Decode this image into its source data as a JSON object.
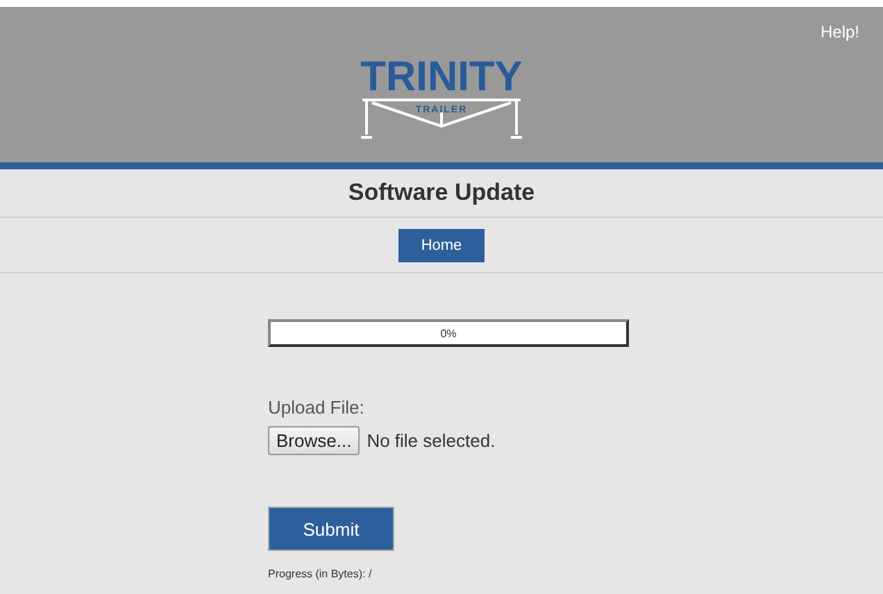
{
  "header": {
    "help_link": "Help!",
    "logo": {
      "title": "TRINITY",
      "subtitle": "TRAILER"
    }
  },
  "page_title": "Software Update",
  "nav": [
    {
      "label": "Home",
      "selected": true
    }
  ],
  "progress": {
    "level": 0,
    "reading": "0%"
  },
  "upload": {
    "label": "Upload File:",
    "browse_button": "Browse...",
    "file_status": "No file selected."
  },
  "submit_button": "Submit",
  "progress_bytes": "Progress (in Bytes): /"
}
